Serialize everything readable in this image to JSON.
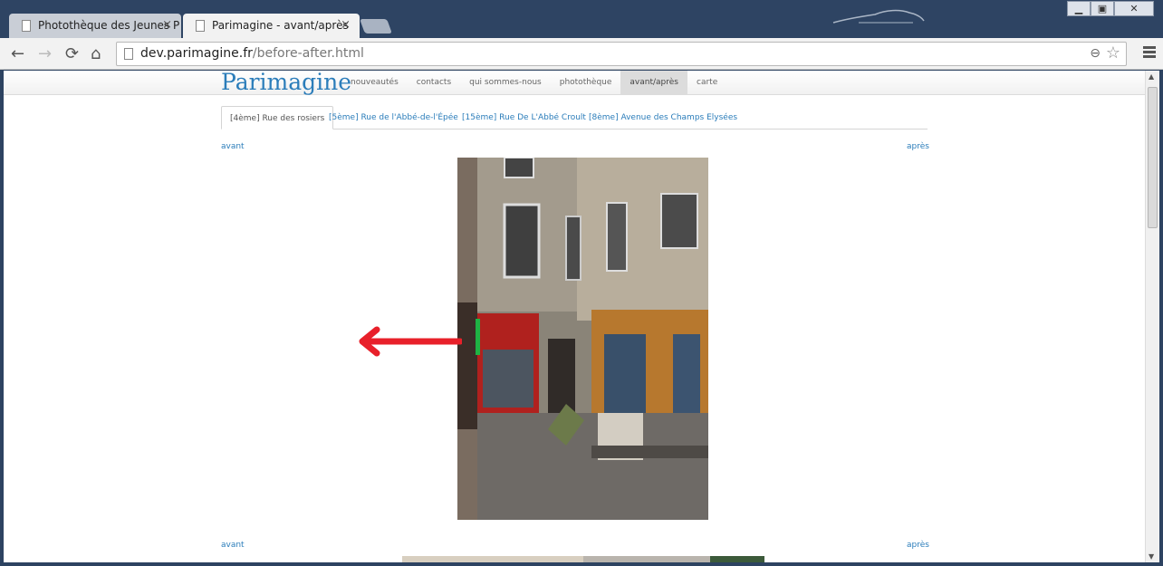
{
  "browser": {
    "tabs": [
      {
        "title": "Photothèque des Jeunes P",
        "close": "×",
        "active": false
      },
      {
        "title": "Parimagine - avant/après",
        "close": "×",
        "active": true
      }
    ],
    "window_buttons": {
      "minimize": "▁",
      "maximize": "▣",
      "close": "✕"
    },
    "nav": {
      "back": "←",
      "forward": "→",
      "reload": "⟳",
      "home": "⌂"
    },
    "address": {
      "domain": "dev.parimagine.fr",
      "path": "/before-after.html"
    },
    "icons": {
      "zoom": "⊖",
      "bookmark": "☆"
    }
  },
  "site": {
    "logo": "Parimagine",
    "menu": [
      "nouveautés",
      "contacts",
      "qui sommes-nous",
      "photothèque",
      "avant/après",
      "carte"
    ],
    "active_menu_index": 4,
    "location_tabs": [
      "[4ème] Rue des rosiers",
      "[5ème] Rue de l'Abbé-de-l'Épée",
      "[15ème] Rue De L'Abbé Croult",
      "[8ème] Avenue des Champs Elysées"
    ],
    "active_tab_index": 0,
    "labels": {
      "before": "avant",
      "after": "après"
    },
    "compare_slider_position": 0.08
  },
  "colors": {
    "accent": "#2b7dba",
    "titlebar": "#2e4463",
    "handle": "#22b24c",
    "annotation_arrow": "#e8202a"
  }
}
